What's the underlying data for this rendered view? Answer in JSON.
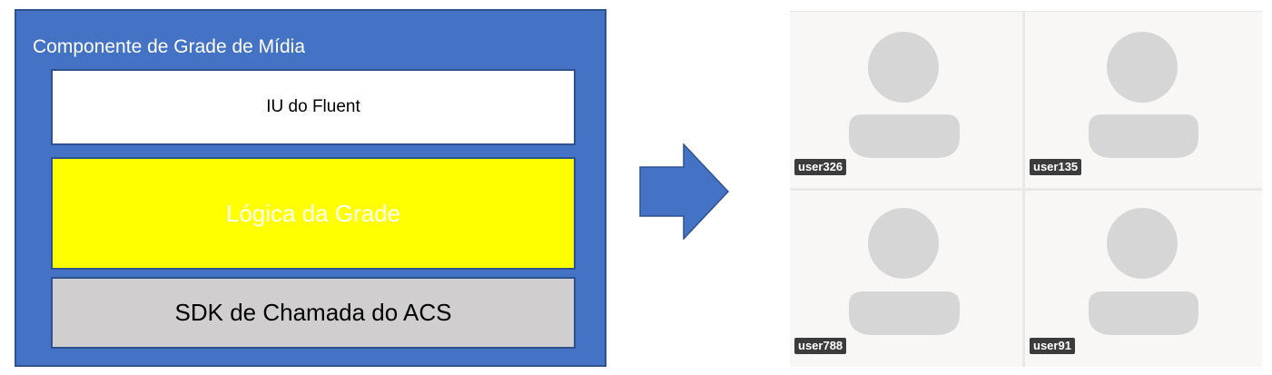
{
  "component": {
    "title": "Componente de Grade de Mídia",
    "layers": {
      "ui_label": "IU do Fluent",
      "logic_label": "Lógica da Grade",
      "sdk_label": "SDK de Chamada do ACS"
    }
  },
  "arrow": {
    "icon": "right-arrow-icon",
    "color": "#4472c4"
  },
  "media_grid": {
    "tiles": [
      {
        "user": "user326",
        "icon": "person-avatar-icon"
      },
      {
        "user": "user135",
        "icon": "person-avatar-icon"
      },
      {
        "user": "user788",
        "icon": "person-avatar-icon"
      },
      {
        "user": "user91",
        "icon": "person-avatar-icon"
      }
    ]
  },
  "colors": {
    "component_fill": "#4472c4",
    "logic_fill": "#ffff00",
    "sdk_fill": "#d0cece",
    "tile_background": "#f8f7f6",
    "avatar_fill": "#d6d6d6"
  }
}
